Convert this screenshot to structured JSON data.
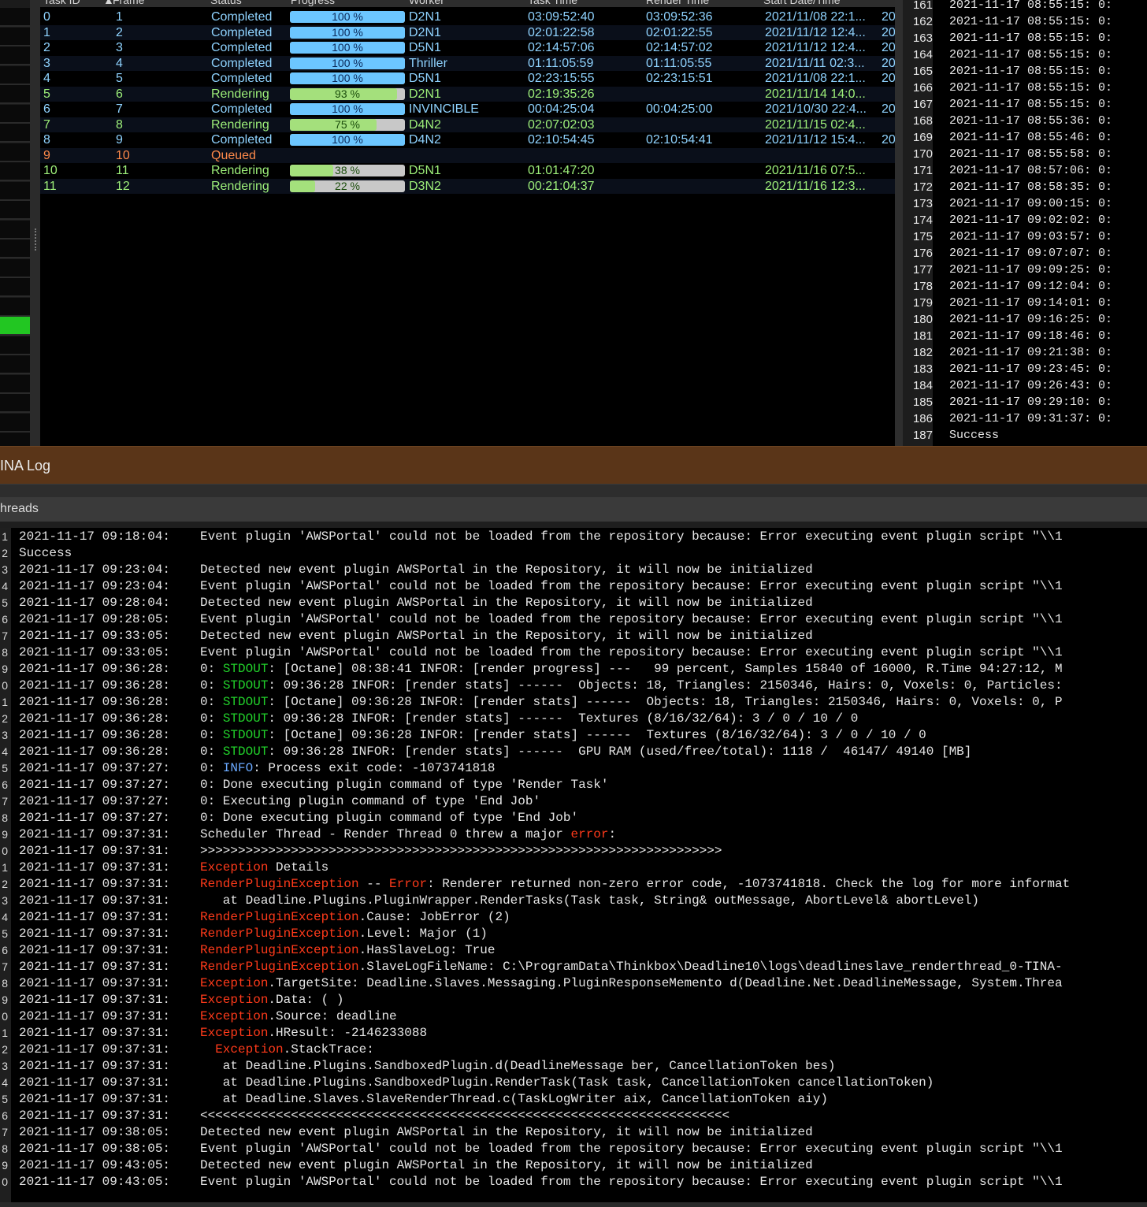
{
  "task_table": {
    "headers": [
      "Task ID",
      "Frame",
      "Status",
      "Progress",
      "Worker",
      "Task Time",
      "Render Time",
      "Start Date/Time"
    ],
    "sort_indicator": "▲",
    "rows": [
      {
        "id": "0",
        "frame": "1",
        "status": "Completed",
        "progress": 100,
        "progress_label": "100 %",
        "worker": "D2N1",
        "task_time": "03:09:52:40",
        "render_time": "03:09:52:36",
        "start": "2021/11/08 22:1...",
        "extra": "20"
      },
      {
        "id": "1",
        "frame": "2",
        "status": "Completed",
        "progress": 100,
        "progress_label": "100 %",
        "worker": "D2N1",
        "task_time": "02:01:22:58",
        "render_time": "02:01:22:55",
        "start": "2021/11/12 12:4...",
        "extra": "20"
      },
      {
        "id": "2",
        "frame": "3",
        "status": "Completed",
        "progress": 100,
        "progress_label": "100 %",
        "worker": "D5N1",
        "task_time": "02:14:57:06",
        "render_time": "02:14:57:02",
        "start": "2021/11/12 12:4...",
        "extra": "20"
      },
      {
        "id": "3",
        "frame": "4",
        "status": "Completed",
        "progress": 100,
        "progress_label": "100 %",
        "worker": "Thriller",
        "task_time": "01:11:05:59",
        "render_time": "01:11:05:55",
        "start": "2021/11/11 02:3...",
        "extra": "20"
      },
      {
        "id": "4",
        "frame": "5",
        "status": "Completed",
        "progress": 100,
        "progress_label": "100 %",
        "worker": "D5N1",
        "task_time": "02:23:15:55",
        "render_time": "02:23:15:51",
        "start": "2021/11/08 22:1...",
        "extra": "20"
      },
      {
        "id": "5",
        "frame": "6",
        "status": "Rendering",
        "progress": 93,
        "progress_label": "93 %",
        "worker": "D2N1",
        "task_time": "02:19:35:26",
        "render_time": "",
        "start": "2021/11/14 14:0...",
        "extra": ""
      },
      {
        "id": "6",
        "frame": "7",
        "status": "Completed",
        "progress": 100,
        "progress_label": "100 %",
        "worker": "INVINCIBLE",
        "task_time": "00:04:25:04",
        "render_time": "00:04:25:00",
        "start": "2021/10/30 22:4...",
        "extra": "20"
      },
      {
        "id": "7",
        "frame": "8",
        "status": "Rendering",
        "progress": 75,
        "progress_label": "75 %",
        "worker": "D4N2",
        "task_time": "02:07:02:03",
        "render_time": "",
        "start": "2021/11/15 02:4...",
        "extra": ""
      },
      {
        "id": "8",
        "frame": "9",
        "status": "Completed",
        "progress": 100,
        "progress_label": "100 %",
        "worker": "D4N2",
        "task_time": "02:10:54:45",
        "render_time": "02:10:54:41",
        "start": "2021/11/12 15:4...",
        "extra": "20"
      },
      {
        "id": "9",
        "frame": "10",
        "status": "Queued",
        "progress": null,
        "progress_label": "",
        "worker": "",
        "task_time": "",
        "render_time": "",
        "start": "",
        "extra": ""
      },
      {
        "id": "10",
        "frame": "11",
        "status": "Rendering",
        "progress": 38,
        "progress_label": "38 %",
        "worker": "D5N1",
        "task_time": "01:01:47:20",
        "render_time": "",
        "start": "2021/11/16 07:5...",
        "extra": ""
      },
      {
        "id": "11",
        "frame": "12",
        "status": "Rendering",
        "progress": 22,
        "progress_label": "22 %",
        "worker": "D3N2",
        "task_time": "00:21:04:37",
        "render_time": "",
        "start": "2021/11/16 12:3...",
        "extra": ""
      }
    ]
  },
  "right_log": [
    {
      "n": "161",
      "t": "2021-11-17 08:55:15:  0:"
    },
    {
      "n": "162",
      "t": "2021-11-17 08:55:15:  0:"
    },
    {
      "n": "163",
      "t": "2021-11-17 08:55:15:  0:"
    },
    {
      "n": "164",
      "t": "2021-11-17 08:55:15:  0:"
    },
    {
      "n": "165",
      "t": "2021-11-17 08:55:15:  0:"
    },
    {
      "n": "166",
      "t": "2021-11-17 08:55:15:  0:"
    },
    {
      "n": "167",
      "t": "2021-11-17 08:55:15:  0:"
    },
    {
      "n": "168",
      "t": "2021-11-17 08:55:36:  0:"
    },
    {
      "n": "169",
      "t": "2021-11-17 08:55:46:  0:"
    },
    {
      "n": "170",
      "t": "2021-11-17 08:55:58:  0:"
    },
    {
      "n": "171",
      "t": "2021-11-17 08:57:06:  0:"
    },
    {
      "n": "172",
      "t": "2021-11-17 08:58:35:  0:"
    },
    {
      "n": "173",
      "t": "2021-11-17 09:00:15:  0:"
    },
    {
      "n": "174",
      "t": "2021-11-17 09:02:02:  0:"
    },
    {
      "n": "175",
      "t": "2021-11-17 09:03:57:  0:"
    },
    {
      "n": "176",
      "t": "2021-11-17 09:07:07:  0:"
    },
    {
      "n": "177",
      "t": "2021-11-17 09:09:25:  0:"
    },
    {
      "n": "178",
      "t": "2021-11-17 09:12:04:  0:"
    },
    {
      "n": "179",
      "t": "2021-11-17 09:14:01:  0:"
    },
    {
      "n": "180",
      "t": "2021-11-17 09:16:25:  0:"
    },
    {
      "n": "181",
      "t": "2021-11-17 09:18:46:  0:"
    },
    {
      "n": "182",
      "t": "2021-11-17 09:21:38:  0:"
    },
    {
      "n": "183",
      "t": "2021-11-17 09:23:45:  0:"
    },
    {
      "n": "184",
      "t": "2021-11-17 09:26:43:  0:"
    },
    {
      "n": "185",
      "t": "2021-11-17 09:29:10:  0:"
    },
    {
      "n": "186",
      "t": "2021-11-17 09:31:37:  0:"
    },
    {
      "n": "187",
      "t": "Success"
    }
  ],
  "log_panel": {
    "title": "INA Log",
    "threads_title": "hreads"
  },
  "bottom_log": [
    {
      "n": "1",
      "ts": "2021-11-17 09:18:04:",
      "segs": [
        [
          "",
          "Event plugin 'AWSPortal' could not be loaded from the repository because: Error executing event plugin script \"\\\\1"
        ]
      ]
    },
    {
      "n": "2",
      "ts": "Success",
      "segs": []
    },
    {
      "n": "3",
      "ts": "2021-11-17 09:23:04:",
      "segs": [
        [
          "",
          "Detected new event plugin AWSPortal in the Repository, it will now be initialized"
        ]
      ]
    },
    {
      "n": "4",
      "ts": "2021-11-17 09:23:04:",
      "segs": [
        [
          "",
          "Event plugin 'AWSPortal' could not be loaded from the repository because: Error executing event plugin script \"\\\\1"
        ]
      ]
    },
    {
      "n": "5",
      "ts": "2021-11-17 09:28:04:",
      "segs": [
        [
          "",
          "Detected new event plugin AWSPortal in the Repository, it will now be initialized"
        ]
      ]
    },
    {
      "n": "6",
      "ts": "2021-11-17 09:28:05:",
      "segs": [
        [
          "",
          "Event plugin 'AWSPortal' could not be loaded from the repository because: Error executing event plugin script \"\\\\1"
        ]
      ]
    },
    {
      "n": "7",
      "ts": "2021-11-17 09:33:05:",
      "segs": [
        [
          "",
          "Detected new event plugin AWSPortal in the Repository, it will now be initialized"
        ]
      ]
    },
    {
      "n": "8",
      "ts": "2021-11-17 09:33:05:",
      "segs": [
        [
          "",
          "Event plugin 'AWSPortal' could not be loaded from the repository because: Error executing event plugin script \"\\\\1"
        ]
      ]
    },
    {
      "n": "9",
      "ts": "2021-11-17 09:36:28:",
      "segs": [
        [
          "",
          "0: "
        ],
        [
          "green",
          "STDOUT"
        ],
        [
          "",
          ": [Octane] 08:38:41 INFOR: [render progress] ---   99 percent, Samples 15840 of 16000, R.Time 94:27:12, M"
        ]
      ]
    },
    {
      "n": "0",
      "ts": "2021-11-17 09:36:28:",
      "segs": [
        [
          "",
          "0: "
        ],
        [
          "green",
          "STDOUT"
        ],
        [
          "",
          ": 09:36:28 INFOR: [render stats] ------  Objects: 18, Triangles: 2150346, Hairs: 0, Voxels: 0, Particles:"
        ]
      ]
    },
    {
      "n": "1",
      "ts": "2021-11-17 09:36:28:",
      "segs": [
        [
          "",
          "0: "
        ],
        [
          "green",
          "STDOUT"
        ],
        [
          "",
          ": [Octane] 09:36:28 INFOR: [render stats] ------  Objects: 18, Triangles: 2150346, Hairs: 0, Voxels: 0, P"
        ]
      ]
    },
    {
      "n": "2",
      "ts": "2021-11-17 09:36:28:",
      "segs": [
        [
          "",
          "0: "
        ],
        [
          "green",
          "STDOUT"
        ],
        [
          "",
          ": 09:36:28 INFOR: [render stats] ------  Textures (8/16/32/64): 3 / 0 / 10 / 0"
        ]
      ]
    },
    {
      "n": "3",
      "ts": "2021-11-17 09:36:28:",
      "segs": [
        [
          "",
          "0: "
        ],
        [
          "green",
          "STDOUT"
        ],
        [
          "",
          ": [Octane] 09:36:28 INFOR: [render stats] ------  Textures (8/16/32/64): 3 / 0 / 10 / 0"
        ]
      ]
    },
    {
      "n": "4",
      "ts": "2021-11-17 09:36:28:",
      "segs": [
        [
          "",
          "0: "
        ],
        [
          "green",
          "STDOUT"
        ],
        [
          "",
          ": 09:36:28 INFOR: [render stats] ------  GPU RAM (used/free/total): 1118 /  46147/ 49140 [MB]"
        ]
      ]
    },
    {
      "n": "5",
      "ts": "2021-11-17 09:37:27:",
      "segs": [
        [
          "",
          "0: "
        ],
        [
          "blue",
          "INFO"
        ],
        [
          "",
          ": Process exit code: -1073741818"
        ]
      ]
    },
    {
      "n": "6",
      "ts": "2021-11-17 09:37:27:",
      "segs": [
        [
          "",
          "0: Done executing plugin command of type 'Render Task'"
        ]
      ]
    },
    {
      "n": "7",
      "ts": "2021-11-17 09:37:27:",
      "segs": [
        [
          "",
          "0: Executing plugin command of type 'End Job'"
        ]
      ]
    },
    {
      "n": "8",
      "ts": "2021-11-17 09:37:27:",
      "segs": [
        [
          "",
          "0: Done executing plugin command of type 'End Job'"
        ]
      ]
    },
    {
      "n": "9",
      "ts": "2021-11-17 09:37:31:",
      "segs": [
        [
          "",
          "Scheduler Thread - Render Thread 0 threw a major "
        ],
        [
          "red",
          "error"
        ],
        [
          "",
          ":"
        ]
      ]
    },
    {
      "n": "0",
      "ts": "2021-11-17 09:37:31:",
      "segs": [
        [
          "",
          ">>>>>>>>>>>>>>>>>>>>>>>>>>>>>>>>>>>>>>>>>>>>>>>>>>>>>>>>>>>>>>>>>>>>>"
        ]
      ]
    },
    {
      "n": "1",
      "ts": "2021-11-17 09:37:31:",
      "segs": [
        [
          "red",
          "Exception"
        ],
        [
          "",
          " Details"
        ]
      ]
    },
    {
      "n": "2",
      "ts": "2021-11-17 09:37:31:",
      "segs": [
        [
          "red",
          "RenderPluginException"
        ],
        [
          "",
          " -- "
        ],
        [
          "red",
          "Error"
        ],
        [
          "",
          ": Renderer returned non-zero error code, -1073741818. Check the log for more informat"
        ]
      ]
    },
    {
      "n": "3",
      "ts": "2021-11-17 09:37:31:",
      "segs": [
        [
          "",
          "   at Deadline.Plugins.PluginWrapper.RenderTasks(Task task, String& outMessage, AbortLevel& abortLevel)"
        ]
      ]
    },
    {
      "n": "4",
      "ts": "2021-11-17 09:37:31:",
      "segs": [
        [
          "red",
          "RenderPluginException"
        ],
        [
          "",
          ".Cause: JobError (2)"
        ]
      ]
    },
    {
      "n": "5",
      "ts": "2021-11-17 09:37:31:",
      "segs": [
        [
          "red",
          "RenderPluginException"
        ],
        [
          "",
          ".Level: Major (1)"
        ]
      ]
    },
    {
      "n": "6",
      "ts": "2021-11-17 09:37:31:",
      "segs": [
        [
          "red",
          "RenderPluginException"
        ],
        [
          "",
          ".HasSlaveLog: True"
        ]
      ]
    },
    {
      "n": "7",
      "ts": "2021-11-17 09:37:31:",
      "segs": [
        [
          "red",
          "RenderPluginException"
        ],
        [
          "",
          ".SlaveLogFileName: C:\\ProgramData\\Thinkbox\\Deadline10\\logs\\deadlineslave_renderthread_0-TINA-"
        ]
      ]
    },
    {
      "n": "8",
      "ts": "2021-11-17 09:37:31:",
      "segs": [
        [
          "red",
          "Exception"
        ],
        [
          "",
          ".TargetSite: Deadline.Slaves.Messaging.PluginResponseMemento d(Deadline.Net.DeadlineMessage, System.Threa"
        ]
      ]
    },
    {
      "n": "9",
      "ts": "2021-11-17 09:37:31:",
      "segs": [
        [
          "red",
          "Exception"
        ],
        [
          "",
          ".Data: ( )"
        ]
      ]
    },
    {
      "n": "0",
      "ts": "2021-11-17 09:37:31:",
      "segs": [
        [
          "red",
          "Exception"
        ],
        [
          "",
          ".Source: deadline"
        ]
      ]
    },
    {
      "n": "1",
      "ts": "2021-11-17 09:37:31:",
      "segs": [
        [
          "red",
          "Exception"
        ],
        [
          "",
          ".HResult: -2146233088"
        ]
      ]
    },
    {
      "n": "2",
      "ts": "2021-11-17 09:37:31:",
      "segs": [
        [
          "",
          "  "
        ],
        [
          "red",
          "Exception"
        ],
        [
          "",
          ".StackTrace:"
        ]
      ]
    },
    {
      "n": "3",
      "ts": "2021-11-17 09:37:31:",
      "segs": [
        [
          "",
          "   at Deadline.Plugins.SandboxedPlugin.d(DeadlineMessage ber, CancellationToken bes)"
        ]
      ]
    },
    {
      "n": "4",
      "ts": "2021-11-17 09:37:31:",
      "segs": [
        [
          "",
          "   at Deadline.Plugins.SandboxedPlugin.RenderTask(Task task, CancellationToken cancellationToken)"
        ]
      ]
    },
    {
      "n": "5",
      "ts": "2021-11-17 09:37:31:",
      "segs": [
        [
          "",
          "   at Deadline.Slaves.SlaveRenderThread.c(TaskLogWriter aix, CancellationToken aiy)"
        ]
      ]
    },
    {
      "n": "6",
      "ts": "2021-11-17 09:37:31:",
      "segs": [
        [
          "",
          "<<<<<<<<<<<<<<<<<<<<<<<<<<<<<<<<<<<<<<<<<<<<<<<<<<<<<<<<<<<<<<<<<<<<<<"
        ]
      ]
    },
    {
      "n": "7",
      "ts": "2021-11-17 09:38:05:",
      "segs": [
        [
          "",
          "Detected new event plugin AWSPortal in the Repository, it will now be initialized"
        ]
      ]
    },
    {
      "n": "8",
      "ts": "2021-11-17 09:38:05:",
      "segs": [
        [
          "",
          "Event plugin 'AWSPortal' could not be loaded from the repository because: Error executing event plugin script \"\\\\1"
        ]
      ]
    },
    {
      "n": "9",
      "ts": "2021-11-17 09:43:05:",
      "segs": [
        [
          "",
          "Detected new event plugin AWSPortal in the Repository, it will now be initialized"
        ]
      ]
    },
    {
      "n": "0",
      "ts": "2021-11-17 09:43:05:",
      "segs": [
        [
          "",
          "Event plugin 'AWSPortal' could not be loaded from the repository because: Error executing event plugin script \"\\\\1"
        ]
      ]
    }
  ],
  "colors": {
    "completed_text": "#8fd3ff",
    "rendering_text": "#9ef07a",
    "queued_text": "#ff8a4a",
    "completed_bar": "#6cc6ff",
    "rendering_bar": "#a4e07c",
    "log_title_bg": "#5a3518",
    "error_red": "#ff3a1a",
    "stdout_green": "#21d02a"
  }
}
